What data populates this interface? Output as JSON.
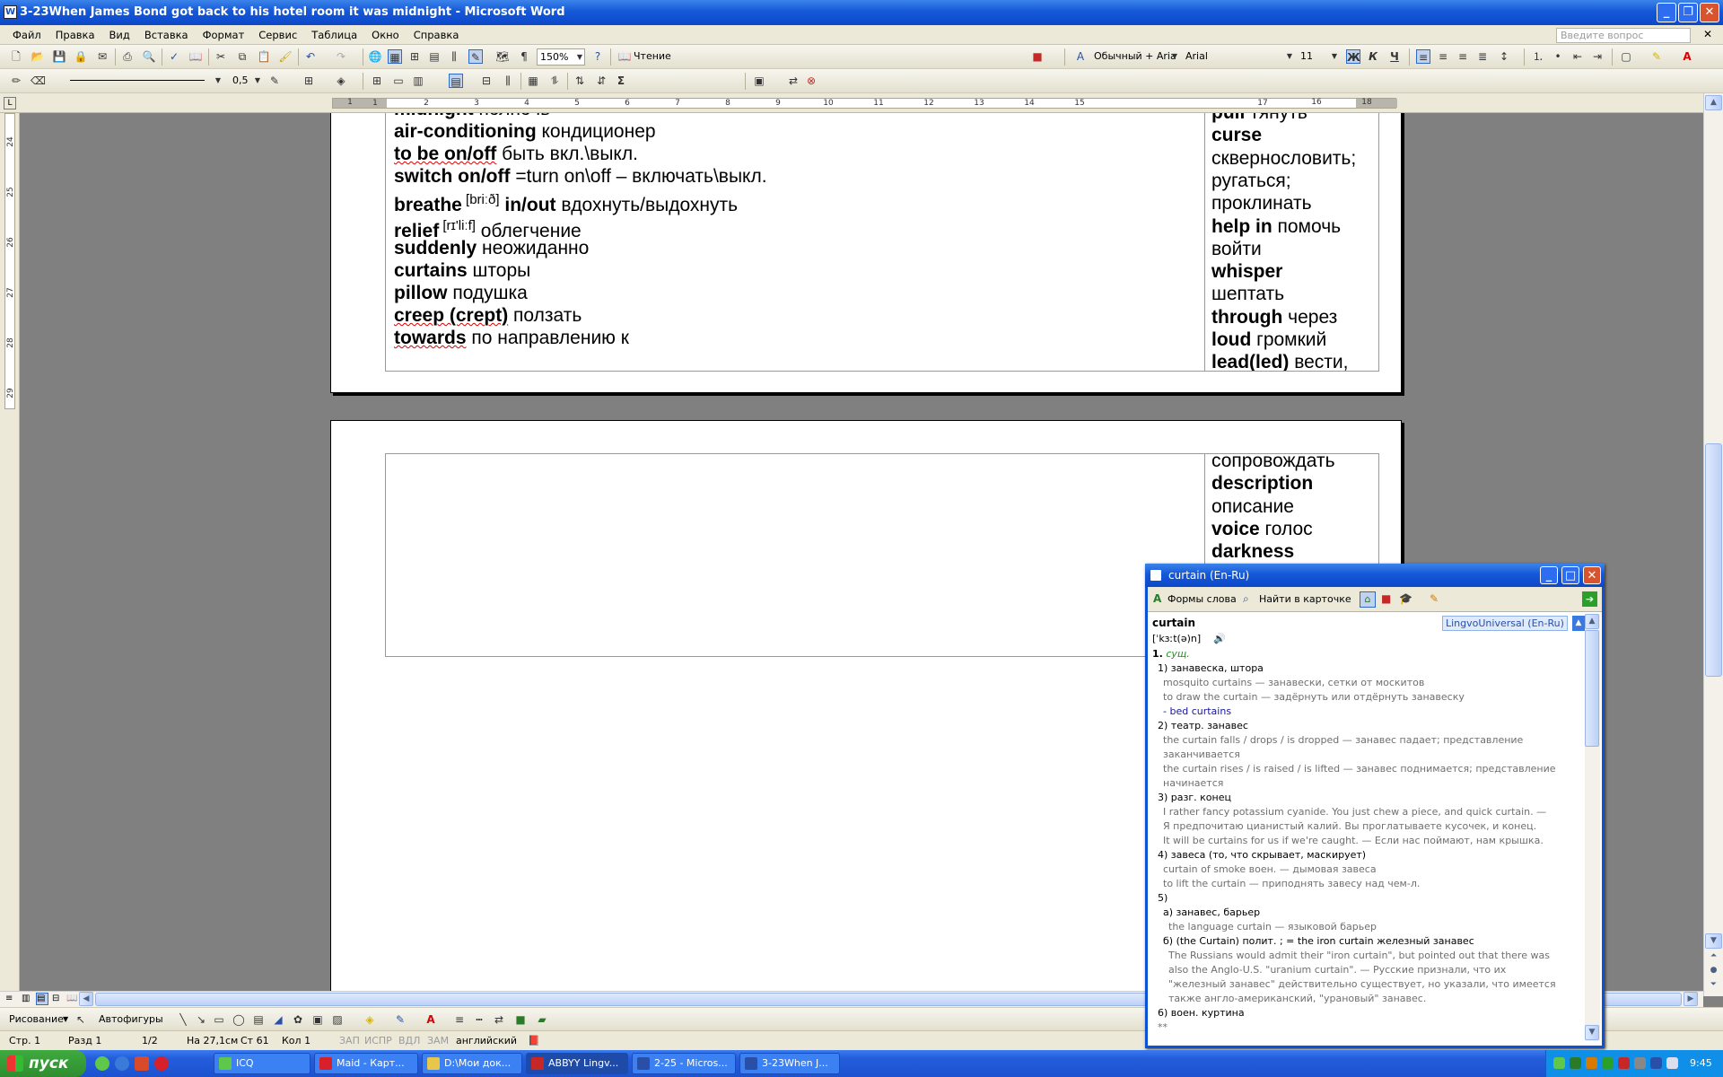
{
  "window": {
    "title": "3-23When James Bond got back to his hotel room it was midnight - Microsoft Word"
  },
  "menu": [
    "Файл",
    "Правка",
    "Вид",
    "Вставка",
    "Формат",
    "Сервис",
    "Таблица",
    "Окно",
    "Справка"
  ],
  "ask_placeholder": "Введите вопрос",
  "toolbar1": {
    "zoom": "150%",
    "reading": "Чтение",
    "style": "Обычный + Aria",
    "font": "Arial",
    "size": "11",
    "bold": "Ж",
    "italic": "К",
    "underline": "Ч"
  },
  "toolbar2": {
    "line_weight": "0,5",
    "sigma": "Σ"
  },
  "ruler": {
    "h_numbers": [
      "1",
      "1",
      "2",
      "3",
      "4",
      "5",
      "6",
      "7",
      "8",
      "9",
      "10",
      "11",
      "12",
      "13",
      "14",
      "15",
      "16",
      "17",
      "18",
      "19"
    ],
    "v_numbers": [
      "24",
      "25",
      "26",
      "27",
      "28",
      "29"
    ]
  },
  "doc": {
    "left_lines": [
      {
        "bold": "midnight",
        "rest": " полночь",
        "partial": true
      },
      {
        "bold": "air-conditioning",
        "rest": " кондиционер"
      },
      {
        "bold": "to be on/off",
        "rest": " быть вкл.\\выкл."
      },
      {
        "bold": "switch on/off",
        "rest": " =turn on\\off – включать\\выкл."
      },
      {
        "bold": "breathe",
        "sup": "[briːð]",
        "bold2": " in/out",
        "rest": " вдохнуть/выдохнуть"
      },
      {
        "bold": "relief",
        "sup": "[rɪ'liːf]",
        "rest": " облегчение"
      },
      {
        "bold": "suddenly",
        "rest": " неожиданно"
      },
      {
        "bold": "curtains",
        "rest": " шторы"
      },
      {
        "bold": "pillow",
        "rest": " подушка"
      },
      {
        "bold": "creep (crept)",
        "rest": " ползать"
      },
      {
        "bold": "towards",
        "rest": " по направлению к"
      }
    ],
    "right_lines_page1": [
      {
        "bold": "pull",
        "rest": " тянуть"
      },
      {
        "bold": "curse",
        "rest": ""
      },
      {
        "bold": "",
        "rest": "сквернословить;"
      },
      {
        "bold": "",
        "rest": "ругаться;"
      },
      {
        "bold": "",
        "rest": "проклинать"
      },
      {
        "bold": "help in",
        "rest": "  помочь"
      },
      {
        "bold": "",
        "rest": "войти"
      },
      {
        "bold": "whisper",
        "rest": ""
      },
      {
        "bold": "",
        "rest": "шептать"
      },
      {
        "bold": "through",
        "rest": " через"
      },
      {
        "bold": "loud",
        "rest": " громкий"
      },
      {
        "bold": "lead(led)",
        "rest": " вести,"
      }
    ],
    "right_lines_page2": [
      {
        "bold": "",
        "rest": "сопровождать"
      },
      {
        "bold": "description",
        "rest": ""
      },
      {
        "bold": "",
        "rest": "описание"
      },
      {
        "bold": "voice",
        "rest": " голос"
      },
      {
        "bold": "darkness",
        "rest": ""
      }
    ]
  },
  "drawbar": {
    "drawing": "Рисование",
    "autoshapes": "Автофигуры"
  },
  "status": {
    "page": "Стр. 1",
    "section": "Разд 1",
    "pages": "1/2",
    "at": "На 27,1см",
    "line": "Ст 61",
    "col": "Кол 1",
    "rec": "ЗАП",
    "trk": "ИСПР",
    "ext": "ВДЛ",
    "ovr": "ЗАМ",
    "lang": "английский"
  },
  "taskbar": {
    "start": "пуск",
    "tasks": [
      "ICQ",
      "Maid - Карт...",
      "D:\\Мои док...",
      "ABBYY Lingv...",
      "2-25 - Micros...",
      "3-23When J..."
    ],
    "active_index": 3,
    "clock": "9:45"
  },
  "lingvo": {
    "title": "curtain (En-Ru)",
    "btn_forms": "Формы слова",
    "btn_find": "Найти в карточке",
    "headword": "curtain",
    "dict": "LingvoUniversal (En-Ru)",
    "transcription": "[ˈkɜːt(ə)n]",
    "pos": "сущ.",
    "lines": [
      {
        "t": "1) занавеска, штора",
        "c": "n",
        "x": 8
      },
      {
        "t": "mosquito curtains — занавески, сетки от москитов",
        "c": "ex",
        "x": 14
      },
      {
        "t": "to draw the curtain — задёрнуть или отдёрнуть занавеску",
        "c": "ex",
        "x": 14
      },
      {
        "t": "- bed curtains",
        "c": "bl",
        "x": 14
      },
      {
        "t": "2) театр. занавес",
        "c": "n",
        "x": 8
      },
      {
        "t": "the curtain falls / drops / is dropped — занавес падает; представление",
        "c": "ex",
        "x": 14
      },
      {
        "t": "заканчивается",
        "c": "ex",
        "x": 14
      },
      {
        "t": "the curtain rises / is raised / is lifted — занавес поднимается; представление",
        "c": "ex",
        "x": 14
      },
      {
        "t": "начинается",
        "c": "ex",
        "x": 14
      },
      {
        "t": "3) разг. конец",
        "c": "n",
        "x": 8
      },
      {
        "t": "I rather fancy potassium cyanide. You just chew a piece, and quick curtain. —",
        "c": "ex",
        "x": 14
      },
      {
        "t": "Я предпочитаю цианистый калий. Вы проглатываете кусочек, и конец.",
        "c": "ex",
        "x": 14
      },
      {
        "t": "It will be curtains for us if we're caught. — Если нас поймают, нам крышка.",
        "c": "ex",
        "x": 14
      },
      {
        "t": "4) завеса (то, что скрывает, маскирует)",
        "c": "n",
        "x": 8
      },
      {
        "t": "curtain of smoke воен. — дымовая завеса",
        "c": "ex",
        "x": 14
      },
      {
        "t": "to lift the curtain — приподнять завесу над чем-л.",
        "c": "ex",
        "x": 14
      },
      {
        "t": "5)",
        "c": "n",
        "x": 8
      },
      {
        "t": "а) занавес, барьер",
        "c": "n",
        "x": 14
      },
      {
        "t": "the language curtain — языковой барьер",
        "c": "ex",
        "x": 20
      },
      {
        "t": "б) (the Curtain) полит. ; = the iron curtain железный занавес",
        "c": "n",
        "x": 14
      },
      {
        "t": "The Russians would admit their \"iron curtain\", but pointed out that there was",
        "c": "ex",
        "x": 20
      },
      {
        "t": "also the Anglo-U.S. \"uranium curtain\". — Русские признали, что их",
        "c": "ex",
        "x": 20
      },
      {
        "t": "\"железный занавес\" действительно существует, но указали, что имеется",
        "c": "ex",
        "x": 20
      },
      {
        "t": "также англо-американский, \"урановый\" занавес.",
        "c": "ex",
        "x": 20
      },
      {
        "t": "6) воен. куртина",
        "c": "n",
        "x": 8
      },
      {
        "t": "**",
        "c": "ex",
        "x": 8
      }
    ]
  }
}
